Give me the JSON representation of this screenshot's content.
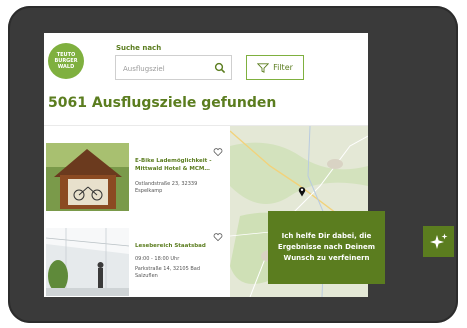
{
  "logo": {
    "text": "TEUTO\nBURGER\nWALD"
  },
  "search": {
    "label": "Suche nach",
    "placeholder": "Ausflugsziel"
  },
  "filter": {
    "label": "Filter"
  },
  "results": {
    "title": "5061 Ausflugsziele gefunden"
  },
  "cards": [
    {
      "title": "E-Bike Lademöglichkeit - Mittwald Hotel & MCM…",
      "address": "Ostlandstraße 23, 32339 Espelkamp",
      "time": ""
    },
    {
      "title": "Lesebereich Staatsbad",
      "time": "09:00 - 18:00 Uhr",
      "address": "Parkstraße 14, 32105 Bad Salzuflen"
    }
  ],
  "assistant": {
    "text": "Ich helfe Dir dabei, die Ergebnisse nach Deinem Wunsch zu verfeinern"
  },
  "colors": {
    "brand_green": "#5b7d1f",
    "logo_green": "#7fb03f"
  }
}
